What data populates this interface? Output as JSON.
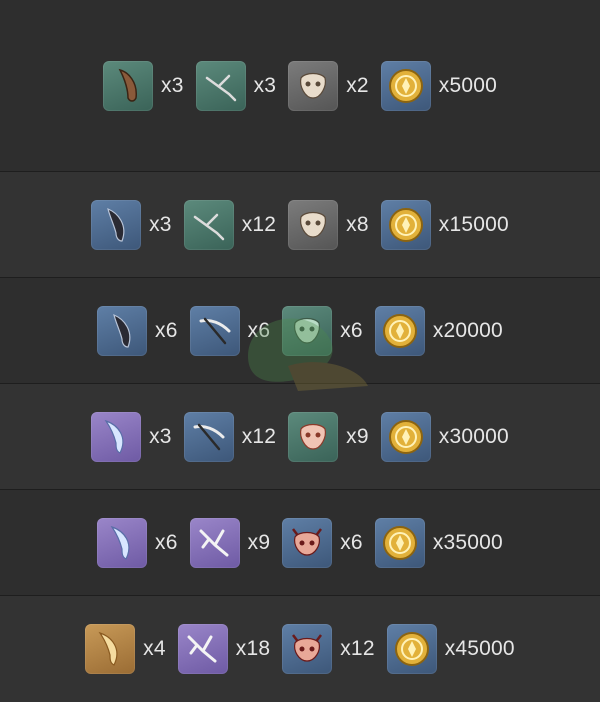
{
  "rows": [
    {
      "items": [
        {
          "icon": "brown-fang-icon",
          "qty": "x3"
        },
        {
          "icon": "twig-icon",
          "qty": "x3"
        },
        {
          "icon": "bone-mask-icon",
          "qty": "x2"
        },
        {
          "icon": "mora-coin-icon",
          "qty": "x5000"
        }
      ]
    },
    {
      "items": [
        {
          "icon": "dark-claw-icon",
          "qty": "x3"
        },
        {
          "icon": "twig-icon",
          "qty": "x12"
        },
        {
          "icon": "bone-mask-icon",
          "qty": "x8"
        },
        {
          "icon": "mora-coin-icon",
          "qty": "x15000"
        }
      ]
    },
    {
      "items": [
        {
          "icon": "dark-claw-icon",
          "qty": "x6"
        },
        {
          "icon": "crossed-bow-icon",
          "qty": "x6"
        },
        {
          "icon": "green-mask-icon",
          "qty": "x6"
        },
        {
          "icon": "mora-coin-icon",
          "qty": "x20000"
        }
      ]
    },
    {
      "items": [
        {
          "icon": "blue-fang-icon",
          "qty": "x3"
        },
        {
          "icon": "crossed-bow-icon",
          "qty": "x12"
        },
        {
          "icon": "red-mask-icon",
          "qty": "x9"
        },
        {
          "icon": "mora-coin-icon",
          "qty": "x30000"
        }
      ]
    },
    {
      "items": [
        {
          "icon": "blue-fang-icon",
          "qty": "x6"
        },
        {
          "icon": "white-branch-icon",
          "qty": "x9"
        },
        {
          "icon": "horned-mask-icon",
          "qty": "x6"
        },
        {
          "icon": "mora-coin-icon",
          "qty": "x35000"
        }
      ]
    },
    {
      "items": [
        {
          "icon": "gold-fang-icon",
          "qty": "x4"
        },
        {
          "icon": "white-branch-icon",
          "qty": "x18"
        },
        {
          "icon": "horned-mask-icon",
          "qty": "x12"
        },
        {
          "icon": "mora-coin-icon",
          "qty": "x45000"
        }
      ]
    }
  ],
  "colors": {
    "background": "#2b2b2b",
    "row_alt": "#333333",
    "text": "#e6e6e6",
    "coin": "#e2b13a"
  }
}
